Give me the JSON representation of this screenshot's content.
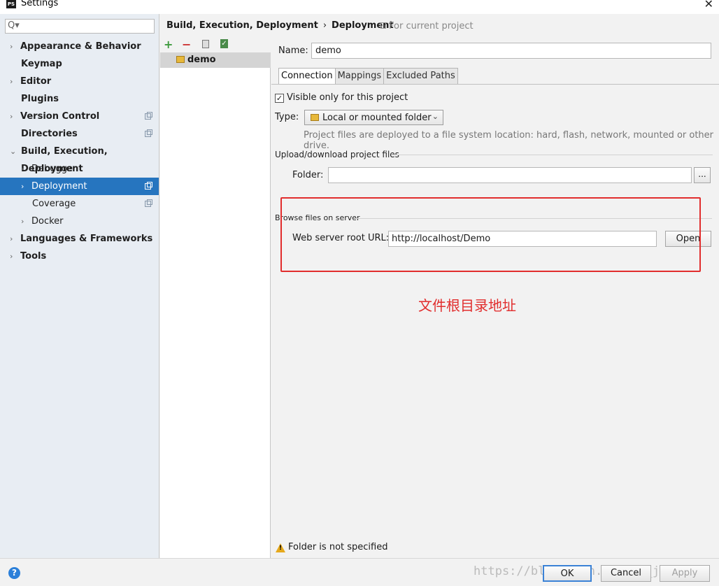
{
  "window": {
    "title": "Settings",
    "app_icon_text": "PS",
    "close_glyph": "✕"
  },
  "search": {
    "icon_glyph": "Q▾",
    "value": ""
  },
  "sidebar": {
    "items": [
      {
        "label": "Appearance & Behavior",
        "arrow": "›"
      },
      {
        "label": "Keymap"
      },
      {
        "label": "Editor",
        "arrow": "›"
      },
      {
        "label": "Plugins"
      },
      {
        "label": "Version Control",
        "arrow": "›"
      },
      {
        "label": "Directories"
      },
      {
        "label": "Build, Execution, Deployment",
        "arrow": "⌄"
      },
      {
        "label": "Debugger",
        "arrow": "›"
      },
      {
        "label": "Deployment",
        "arrow": "›"
      },
      {
        "label": "Coverage"
      },
      {
        "label": "Docker",
        "arrow": "›"
      },
      {
        "label": "Languages & Frameworks",
        "arrow": "›"
      },
      {
        "label": "Tools",
        "arrow": "›"
      }
    ]
  },
  "breadcrumb": {
    "parent": "Build, Execution, Deployment",
    "separator": "›",
    "current": "Deployment",
    "note": "For current project"
  },
  "toolbar": {
    "add_glyph": "+",
    "remove_glyph": "−",
    "check_glyph": "✓"
  },
  "servers": [
    {
      "name": "demo"
    }
  ],
  "form": {
    "name_label": "Name:",
    "name_value": "demo",
    "tabs": [
      "Connection",
      "Mappings",
      "Excluded Paths"
    ],
    "visible_only_label": "Visible only for this project",
    "checkbox_glyph": "✓",
    "type_label": "Type:",
    "type_value": "Local or mounted folder",
    "type_caret": "⌄",
    "hint": "Project files are deployed to a file system location: hard, flash, network, mounted or other drive.",
    "upload_group": "Upload/download project files",
    "folder_label": "Folder:",
    "folder_value": "",
    "browse_label": "...",
    "browse_group": "Browse files on server",
    "url_label": "Web server root URL:",
    "url_value": "http://localhost/Demo",
    "open_label": "Open"
  },
  "annotation": {
    "text": "文件根目录地址",
    "color": "#e12d2d"
  },
  "status": {
    "warning": "Folder is not specified"
  },
  "footer": {
    "help_glyph": "?",
    "ok": "OK",
    "cancel": "Cancel",
    "apply": "Apply",
    "watermark": "https://blog.csdn.net/TF_jingfang"
  },
  "colors": {
    "selection": "#2675bf",
    "accent": "#3b82d6"
  }
}
